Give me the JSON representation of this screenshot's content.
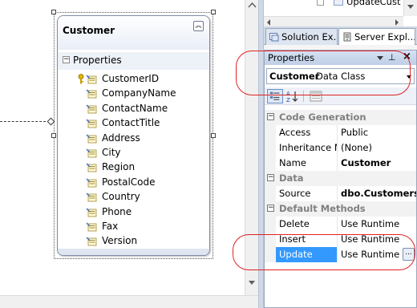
{
  "entity": {
    "title": "Customer",
    "section_label": "Properties",
    "properties": [
      "CustomerID",
      "CompanyName",
      "ContactName",
      "ContactTitle",
      "Address",
      "City",
      "Region",
      "PostalCode",
      "Country",
      "Phone",
      "Fax",
      "Version"
    ]
  },
  "tree": {
    "item_label": "UpdateCust"
  },
  "tabs": [
    {
      "label": "Solution Ex..."
    },
    {
      "label": "Server Expl..."
    }
  ],
  "properties_window": {
    "title": "Properties",
    "object_name": "Customer",
    "object_type": "Data Class",
    "categories": [
      {
        "label": "Code Generation",
        "rows": [
          {
            "name": "Access",
            "value": "Public"
          },
          {
            "name": "Inheritance M",
            "value": "(None)"
          },
          {
            "name": "Name",
            "value": "Customer"
          }
        ]
      },
      {
        "label": "Data",
        "rows": [
          {
            "name": "Source",
            "value": "dbo.Customers"
          }
        ]
      },
      {
        "label": "Default Methods",
        "rows": [
          {
            "name": "Delete",
            "value": "Use Runtime"
          },
          {
            "name": "Insert",
            "value": "Use Runtime"
          },
          {
            "name": "Update",
            "value": "Use Runtime"
          }
        ]
      }
    ],
    "ellipsis_label": "..."
  },
  "colors": {
    "selection": "#3399ff",
    "callout": "#e02222",
    "category_text": "#808080"
  }
}
